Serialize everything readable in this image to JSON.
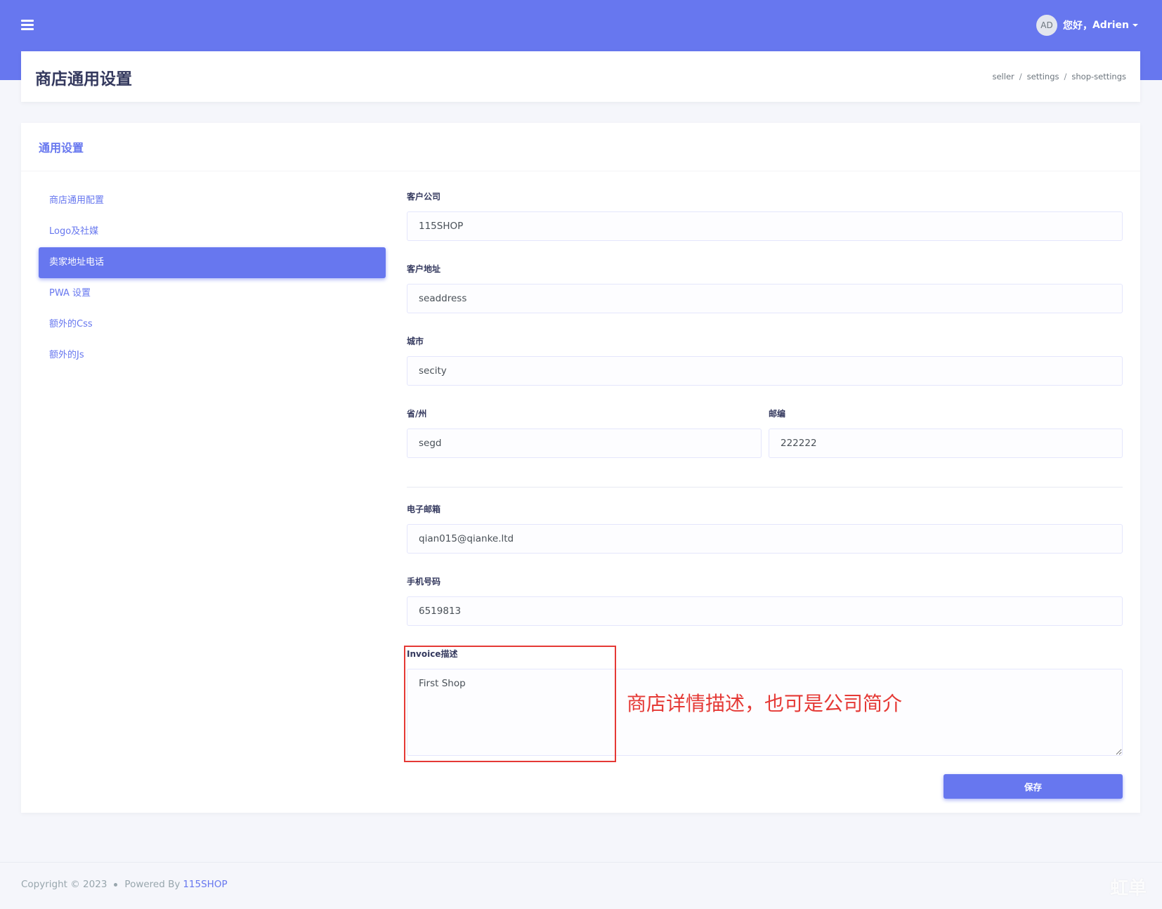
{
  "header": {
    "avatar_initials": "AD",
    "greeting": "您好，",
    "username": "Adrien"
  },
  "page": {
    "title": "商店通用设置",
    "breadcrumb": [
      "seller",
      "settings",
      "shop-settings"
    ]
  },
  "card": {
    "title": "通用设置"
  },
  "sidebar": {
    "items": [
      {
        "label": "商店通用配置",
        "active": false
      },
      {
        "label": "Logo及社媒",
        "active": false
      },
      {
        "label": "卖家地址电话",
        "active": true
      },
      {
        "label": "PWA 设置",
        "active": false
      },
      {
        "label": "额外的Css",
        "active": false
      },
      {
        "label": "额外的Js",
        "active": false
      }
    ]
  },
  "form": {
    "company": {
      "label": "客户公司",
      "value": "115SHOP"
    },
    "address": {
      "label": "客户地址",
      "value": "seaddress"
    },
    "city": {
      "label": "城市",
      "value": "secity"
    },
    "state": {
      "label": "省/州",
      "value": "segd"
    },
    "zip": {
      "label": "邮编",
      "value": "222222"
    },
    "email": {
      "label": "电子邮箱",
      "value": "qian015@qianke.ltd"
    },
    "phone": {
      "label": "手机号码",
      "value": "6519813"
    },
    "invoice": {
      "label": "Invoice描述",
      "value": "First Shop"
    },
    "save_label": "保存"
  },
  "annotation": {
    "text": "商店详情描述，也可是公司简介",
    "color": "#e53935"
  },
  "footer": {
    "copyright": "Copyright © 2023",
    "powered_by": "Powered By",
    "brand": "115SHOP"
  },
  "watermark": "虹单",
  "colors": {
    "primary": "#6777ef",
    "annotation": "#e53935"
  }
}
